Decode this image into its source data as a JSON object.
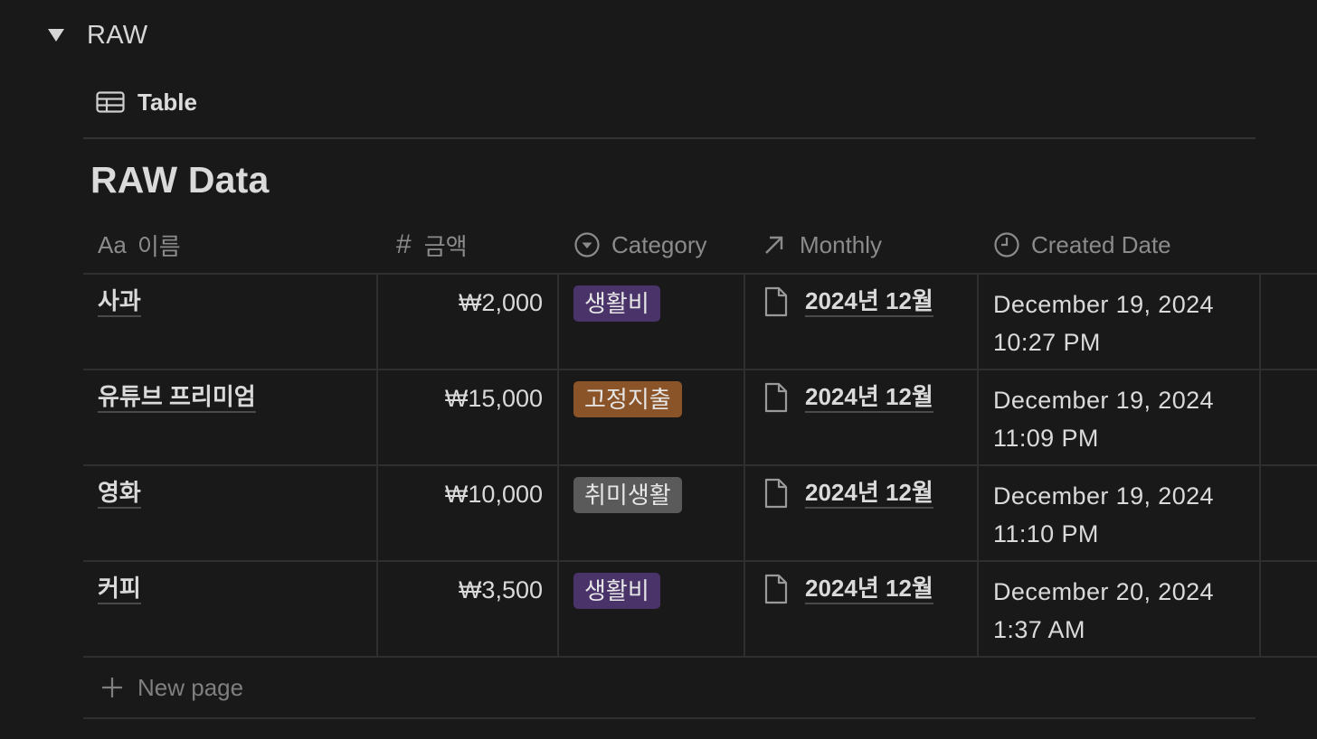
{
  "toggle": {
    "title": "RAW",
    "icon": "triangle-down-icon"
  },
  "view": {
    "label": "Table",
    "icon": "table-icon"
  },
  "database": {
    "title": "RAW Data"
  },
  "columns": [
    {
      "icon_text": "Aa",
      "label": "이름",
      "icon": "title-property-icon"
    },
    {
      "icon_text": "#",
      "label": "금액",
      "icon": "number-property-icon"
    },
    {
      "label": "Category",
      "icon": "select-property-icon"
    },
    {
      "label": "Monthly",
      "icon": "relation-arrow-icon"
    },
    {
      "label": "Created Date",
      "icon": "clock-icon"
    }
  ],
  "rows": [
    {
      "name": "사과",
      "amount": "₩2,000",
      "category": "생활비",
      "category_color": "#4a3369",
      "monthly": "2024년 12월",
      "date_line1": "December 19, 2024",
      "date_line2": "10:27 PM"
    },
    {
      "name": "유튜브 프리미엄",
      "amount": "₩15,000",
      "category": "고정지출",
      "category_color": "#8a5428",
      "monthly": "2024년 12월",
      "date_line1": "December 19, 2024",
      "date_line2": "11:09 PM"
    },
    {
      "name": "영화",
      "amount": "₩10,000",
      "category": "취미생활",
      "category_color": "#5a5a5a",
      "monthly": "2024년 12월",
      "date_line1": "December 19, 2024",
      "date_line2": "11:10 PM"
    },
    {
      "name": "커피",
      "amount": "₩3,500",
      "category": "생활비",
      "category_color": "#4a3369",
      "monthly": "2024년 12월",
      "date_line1": "December 20, 2024",
      "date_line2": "1:37 AM"
    }
  ],
  "new_page": {
    "label": "New page",
    "icon": "plus-icon"
  },
  "colors": {
    "background": "#191919",
    "border": "#2f2f2f",
    "muted": "#8b8b8b"
  }
}
